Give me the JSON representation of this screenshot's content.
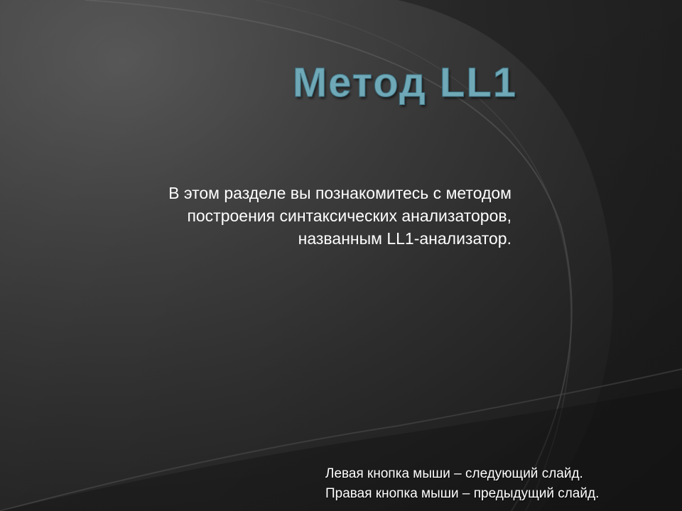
{
  "slide": {
    "title": "Метод LL1",
    "body_lines": [
      "В этом разделе вы познакомитесь с методом",
      "построения синтаксических анализаторов,",
      "названным LL1-анализатор."
    ],
    "footer_lines": [
      "Левая кнопка мыши – следующий слайд.",
      "Правая кнопка мыши – предыдущий слайд."
    ]
  },
  "colors": {
    "background": "#2b2b2b",
    "title_text": "#6fa8b6",
    "body_text": "#ffffff"
  }
}
